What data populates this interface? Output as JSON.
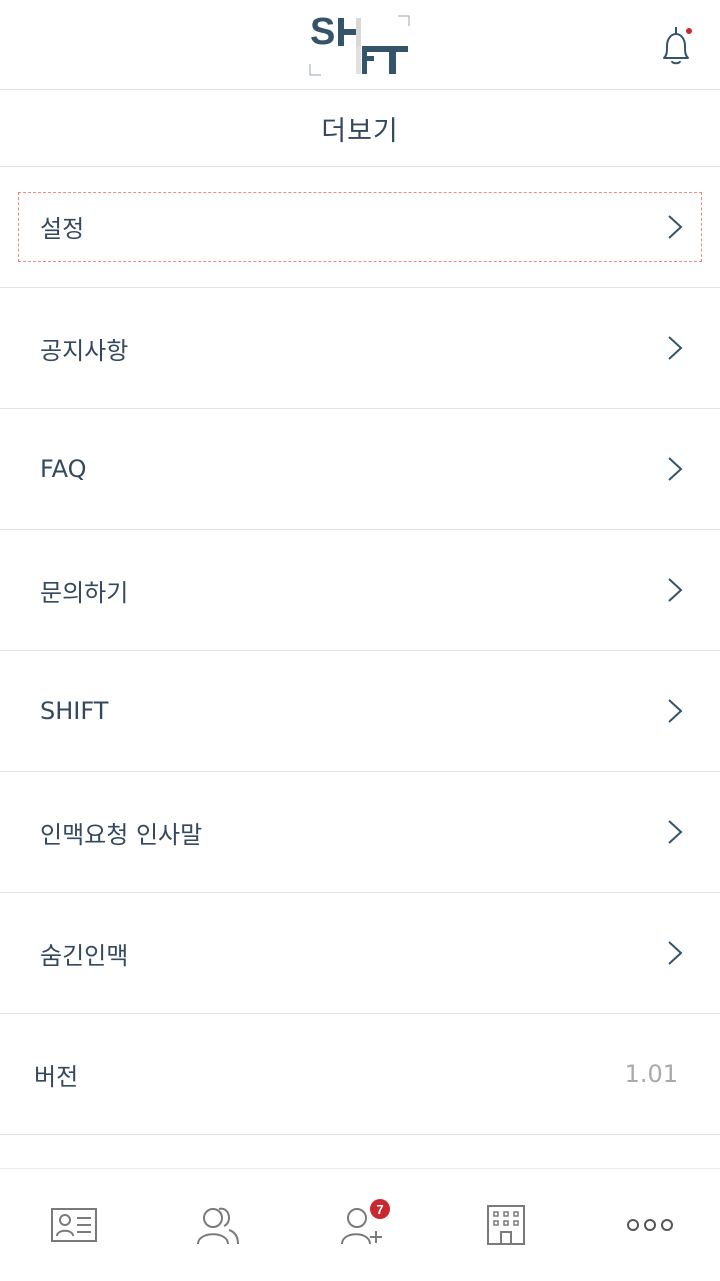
{
  "header": {
    "logo_text": "SHIFT",
    "notification_dot_color": "#c8282e"
  },
  "page": {
    "title": "더보기"
  },
  "menu": {
    "items": [
      {
        "label": "설정"
      },
      {
        "label": "공지사항"
      },
      {
        "label": "FAQ"
      },
      {
        "label": "문의하기"
      },
      {
        "label": "SHIFT"
      },
      {
        "label": "인맥요청 인사말"
      },
      {
        "label": "숨긴인맥"
      }
    ],
    "version": {
      "label": "버전",
      "value": "1.01"
    }
  },
  "tabbar": {
    "tabs": [
      {
        "icon": "profile-card-icon"
      },
      {
        "icon": "contacts-icon"
      },
      {
        "icon": "add-contact-icon",
        "badge": "7"
      },
      {
        "icon": "building-icon"
      },
      {
        "icon": "more-icon"
      }
    ]
  }
}
